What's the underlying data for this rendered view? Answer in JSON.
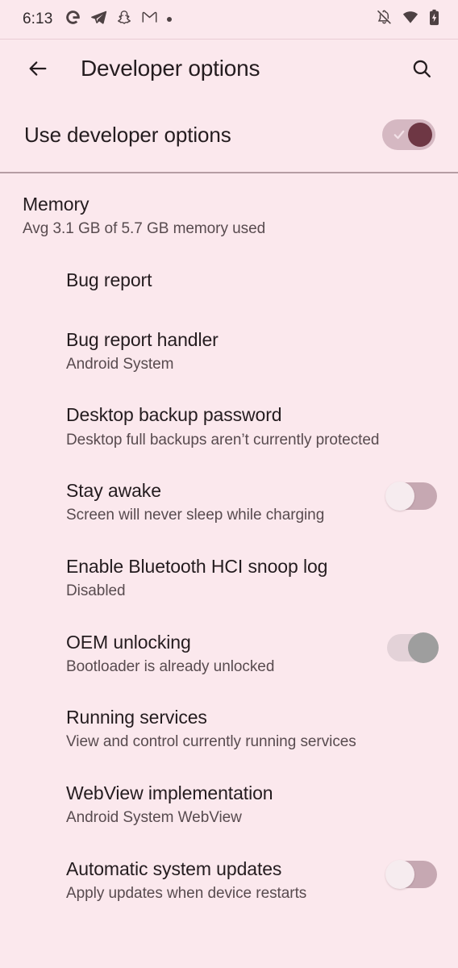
{
  "theme": {
    "background": "#fbe8ed",
    "text_primary": "#241c1f",
    "text_secondary": "#584b4f",
    "accent_thumb_on": "#6e3744",
    "track_on": "#d5b8c2",
    "track_off": "#c6a8b2",
    "thumb_off": "#f6ecef",
    "thumb_disabled": "#9e9e9e",
    "divider": "#a88f97"
  },
  "status_bar": {
    "time": "6:13",
    "notification_icons": [
      "google-icon",
      "telegram-icon",
      "snapchat-icon",
      "gmail-icon",
      "notification-dot"
    ],
    "system_icons": [
      "notifications-muted-icon",
      "wifi-icon",
      "battery-charging-icon"
    ]
  },
  "app_bar": {
    "back_label": "Back",
    "title": "Developer options",
    "search_label": "Search"
  },
  "master_switch": {
    "label": "Use developer options",
    "state": "on",
    "state_label": "On"
  },
  "settings": [
    {
      "title": "Memory",
      "subtitle": "Avg 3.1 GB of 5.7 GB memory used",
      "icon": "memory-chip-icon",
      "control": "none"
    },
    {
      "title": "Bug report",
      "subtitle": "",
      "icon": "",
      "control": "none"
    },
    {
      "title": "Bug report handler",
      "subtitle": "Android System",
      "icon": "",
      "control": "none"
    },
    {
      "title": "Desktop backup password",
      "subtitle": "Desktop full backups aren’t currently protected",
      "icon": "",
      "control": "none"
    },
    {
      "title": "Stay awake",
      "subtitle": "Screen will never sleep while charging",
      "icon": "",
      "control": "switch",
      "switch_state": "off"
    },
    {
      "title": "Enable Bluetooth HCI snoop log",
      "subtitle": "Disabled",
      "icon": "",
      "control": "none"
    },
    {
      "title": "OEM unlocking",
      "subtitle": "Bootloader is already unlocked",
      "icon": "",
      "control": "switch",
      "switch_state": "on-disabled"
    },
    {
      "title": "Running services",
      "subtitle": "View and control currently running services",
      "icon": "",
      "control": "none"
    },
    {
      "title": "WebView implementation",
      "subtitle": "Android System WebView",
      "icon": "",
      "control": "none"
    },
    {
      "title": "Automatic system updates",
      "subtitle": "Apply updates when device restarts",
      "icon": "",
      "control": "switch",
      "switch_state": "off"
    }
  ]
}
